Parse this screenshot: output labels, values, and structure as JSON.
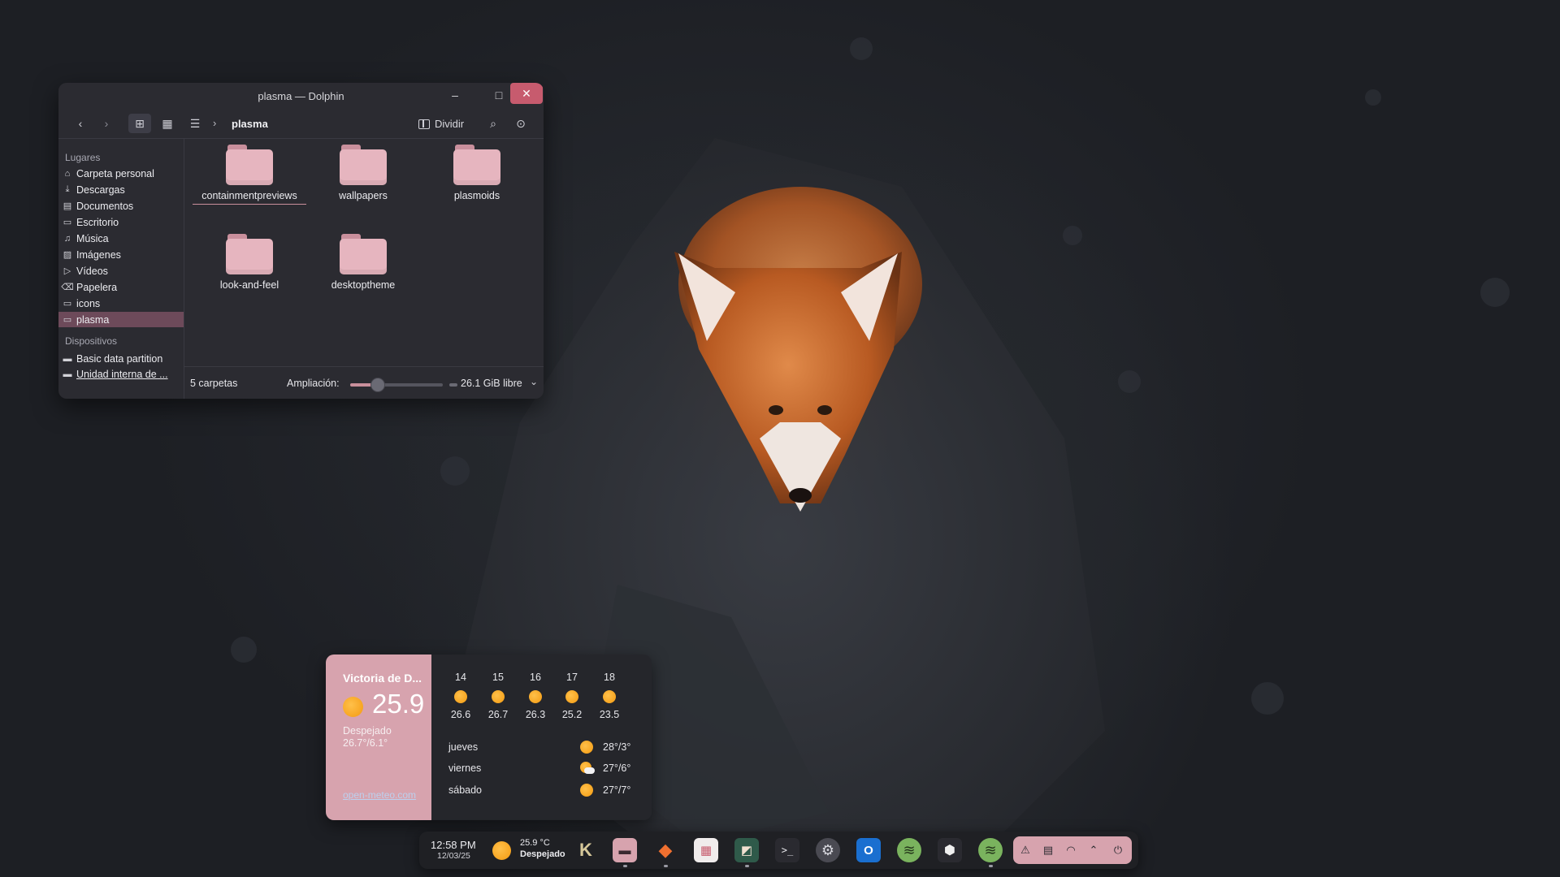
{
  "window": {
    "title": "plasma — Dolphin",
    "minimize": "–",
    "maximize": "□",
    "close": "✕"
  },
  "toolbar": {
    "back_icon": "arrow-left-icon",
    "forward_icon": "arrow-right-icon",
    "breadcrumb": "plasma",
    "split_label": "Dividir"
  },
  "sidebar": {
    "places_header": "Lugares",
    "places": [
      {
        "label": "Carpeta personal",
        "icon": "home-icon"
      },
      {
        "label": "Descargas",
        "icon": "download-icon"
      },
      {
        "label": "Documentos",
        "icon": "document-icon"
      },
      {
        "label": "Escritorio",
        "icon": "desktop-icon"
      },
      {
        "label": "Música",
        "icon": "music-icon"
      },
      {
        "label": "Imágenes",
        "icon": "image-icon"
      },
      {
        "label": "Vídeos",
        "icon": "video-icon"
      },
      {
        "label": "Papelera",
        "icon": "trash-icon"
      },
      {
        "label": "icons",
        "icon": "folder-icon"
      },
      {
        "label": "plasma",
        "icon": "folder-icon"
      }
    ],
    "devices_header": "Dispositivos",
    "devices": [
      {
        "label": "Basic data partition",
        "icon": "drive-icon"
      },
      {
        "label": "Unidad interna de ...",
        "icon": "drive-icon"
      }
    ]
  },
  "folders": [
    {
      "name": "containmentpreviews"
    },
    {
      "name": "wallpapers"
    },
    {
      "name": "plasmoids"
    },
    {
      "name": "look-and-feel"
    },
    {
      "name": "desktoptheme"
    }
  ],
  "status": {
    "count": "5 carpetas",
    "zoom_label": "Ampliación:",
    "zoom_level": 0.3,
    "free_space": "26.1 GiB libre"
  },
  "weather": {
    "city": "Victoria de D...",
    "temp": "25.9",
    "condition": "Despejado",
    "range": "26.7°/6.1°",
    "source": "open-meteo.com",
    "hourly": [
      {
        "hour": "14",
        "temp": "26.6"
      },
      {
        "hour": "15",
        "temp": "26.7"
      },
      {
        "hour": "16",
        "temp": "26.3"
      },
      {
        "hour": "17",
        "temp": "25.2"
      },
      {
        "hour": "18",
        "temp": "23.5"
      }
    ],
    "daily": [
      {
        "day": "jueves",
        "temps": "28°/3°",
        "icon": "sun-icon"
      },
      {
        "day": "viernes",
        "temps": "27°/6°",
        "icon": "cloud-sun-icon"
      },
      {
        "day": "sábado",
        "temps": "27°/7°",
        "icon": "sun-icon"
      }
    ]
  },
  "panel": {
    "time": "12:58 PM",
    "date": "12/03/25",
    "temp": "25.9 °C",
    "condition": "Despejado",
    "apps": [
      {
        "name": "kde-icon",
        "glyph": "K"
      },
      {
        "name": "file-manager-icon",
        "glyph": "▬"
      },
      {
        "name": "gitlab-icon",
        "glyph": "◆"
      },
      {
        "name": "store-icon",
        "glyph": "▦"
      },
      {
        "name": "image-viewer-icon",
        "glyph": "◩"
      },
      {
        "name": "terminal-icon",
        "glyph": ">_"
      },
      {
        "name": "settings-icon",
        "glyph": "⚙"
      },
      {
        "name": "outlook-icon",
        "glyph": "O"
      },
      {
        "name": "spotify-icon",
        "glyph": "≋"
      },
      {
        "name": "package-icon",
        "glyph": "⬢"
      },
      {
        "name": "spotify-icon",
        "glyph": "≋"
      }
    ],
    "tray": [
      {
        "name": "notification-icon",
        "glyph": "⚠"
      },
      {
        "name": "clipboard-icon",
        "glyph": "▤"
      },
      {
        "name": "wifi-icon",
        "glyph": "◠"
      },
      {
        "name": "chevron-up-icon",
        "glyph": "⌃"
      },
      {
        "name": "power-icon",
        "glyph": "⏻"
      }
    ]
  },
  "colors": {
    "accent": "#d7a3ae",
    "close_button": "#c75b6e",
    "folder": "#e6b5bf",
    "sun": "#f49a10"
  }
}
